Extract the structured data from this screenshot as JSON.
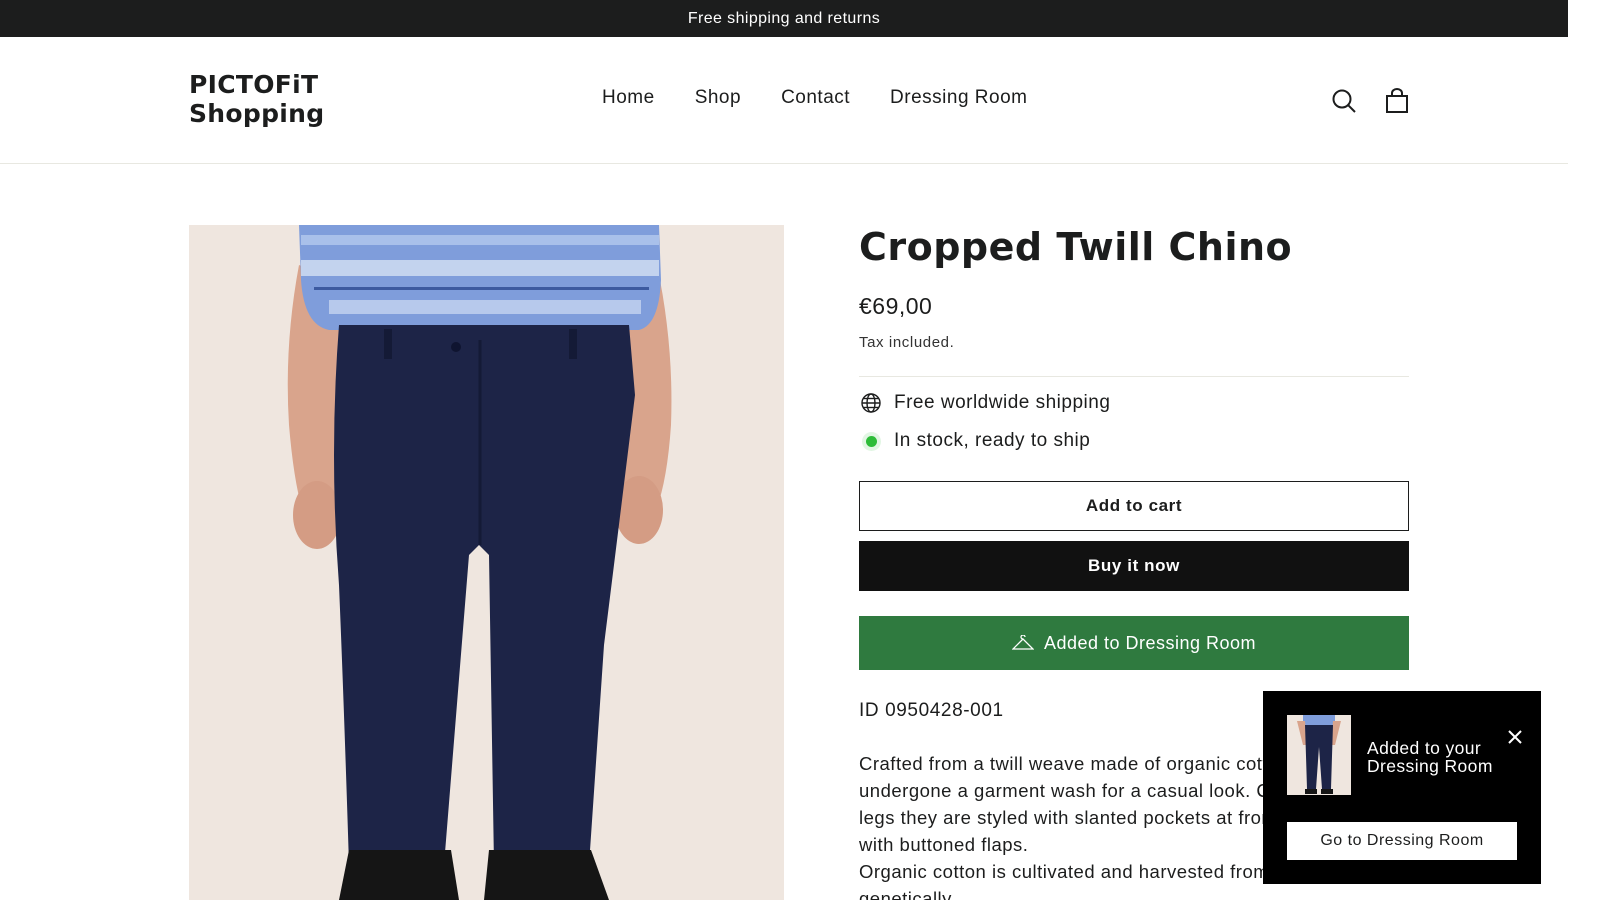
{
  "announcement": "Free shipping and returns",
  "header": {
    "logo_line1": "PICTOFiT",
    "logo_line2": "Shopping",
    "nav": [
      "Home",
      "Shop",
      "Contact",
      "Dressing Room"
    ],
    "icons": [
      "search-icon",
      "cart-icon"
    ]
  },
  "product": {
    "title": "Cropped Twill Chino",
    "price": "€69,00",
    "tax_note": "Tax included.",
    "features": [
      "Free worldwide shipping",
      "In stock, ready to ship"
    ],
    "add_to_cart": "Add to cart",
    "buy_now": "Buy it now",
    "dressing_room_status": "Added to Dressing Room",
    "id_label": "ID 0950428-001",
    "description_lines": [
      "Crafted from a twill weave made of organic cotton,",
      "undergone a garment wash for a casual look. Cut w",
      "legs they are styled with slanted pockets at front and",
      "with buttoned flaps.",
      "Organic cotton is cultivated and harvested from non-genetically"
    ]
  },
  "toast": {
    "line1": "Added to your",
    "line2": "Dressing Room",
    "button": "Go to Dressing Room"
  },
  "colors": {
    "announcement_bg": "#1c1d1d",
    "buy_button": "#111111",
    "dressing_room_button": "#2f7a3f",
    "stock_dot": "#2ebc39",
    "toast_bg": "#000000",
    "image_bg": "#efe6df"
  }
}
